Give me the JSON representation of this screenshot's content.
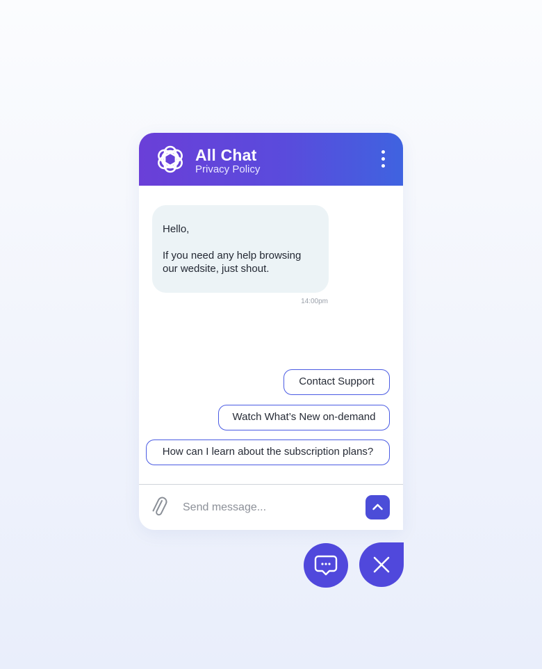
{
  "header": {
    "title": "All Chat",
    "subtitle": "Privacy Policy",
    "logo_icon": "openai-knot-icon",
    "menu_icon": "more-vertical-icon"
  },
  "conversation": {
    "messages": [
      {
        "paragraphs": [
          "Hello,",
          "If you need any help browsing our wedsite, just shout."
        ],
        "time": "14:00pm"
      }
    ]
  },
  "quick_replies": [
    "Contact Support",
    "Watch What’s New on-demand",
    "How can I learn about the subscription plans?"
  ],
  "composer": {
    "placeholder": "Send message...",
    "attach_icon": "paperclip-icon",
    "send_icon": "chevron-up-icon"
  },
  "launcher": {
    "chat_icon": "chat-bubble-icon",
    "close_icon": "close-icon"
  },
  "colors": {
    "accent": "#5048dc",
    "header_start": "#6a3fd8",
    "header_end": "#3f63e0",
    "bubble_bg": "#ecf3f6",
    "chip_border": "#4a5be3"
  }
}
